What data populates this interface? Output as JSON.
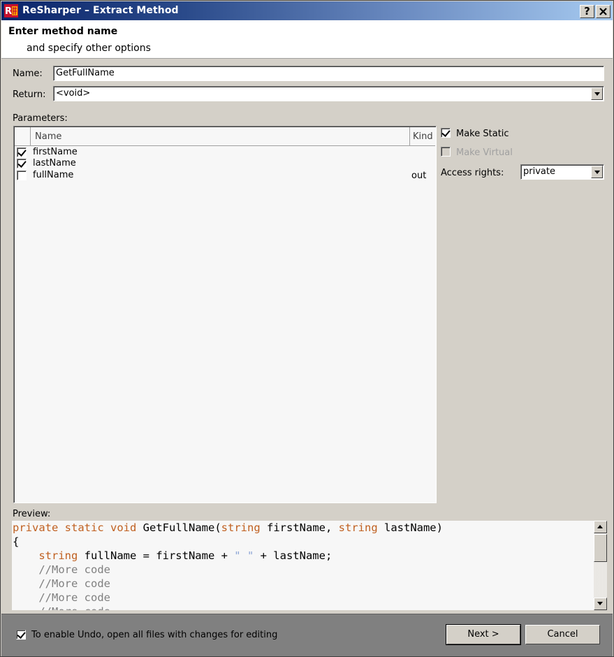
{
  "window": {
    "title": "ReSharper – Extract Method",
    "help_label": "?",
    "close_label": "✕",
    "icon": "resharper-logo-icon"
  },
  "header": {
    "title": "Enter method name",
    "subtitle": "and specify other options"
  },
  "form": {
    "name_label": "Name:",
    "name_value": "GetFullName",
    "return_label": "Return:",
    "return_value": "<void>",
    "parameters_label": "Parameters:"
  },
  "parameters": {
    "columns": {
      "name": "Name",
      "kind": "Kind"
    },
    "rows": [
      {
        "checked": true,
        "name": "firstName",
        "kind": ""
      },
      {
        "checked": true,
        "name": "lastName",
        "kind": ""
      },
      {
        "checked": false,
        "name": "fullName",
        "kind": "out"
      }
    ]
  },
  "options": {
    "make_static_label": "Make Static",
    "make_static_checked": true,
    "make_virtual_label": "Make Virtual",
    "make_virtual_checked": false,
    "make_virtual_enabled": false,
    "access_rights_label": "Access rights:",
    "access_rights_value": "private"
  },
  "preview": {
    "label": "Preview:",
    "lines": [
      "private static void GetFullName(string firstName, string lastName)",
      "{",
      "    string fullName = firstName + \" \" + lastName;",
      "    //More code",
      "    //More code",
      "    //More code",
      "    //More code"
    ]
  },
  "footer": {
    "undo_label": "To enable Undo, open all files with changes for editing",
    "undo_checked": true,
    "next_label": "Next >",
    "cancel_label": "Cancel"
  },
  "colors": {
    "keyword": "#c06020",
    "string_literal": "#8fa6d6",
    "comment": "#808080",
    "titlebar_start": "#0a246a",
    "titlebar_end": "#a6caf0"
  }
}
